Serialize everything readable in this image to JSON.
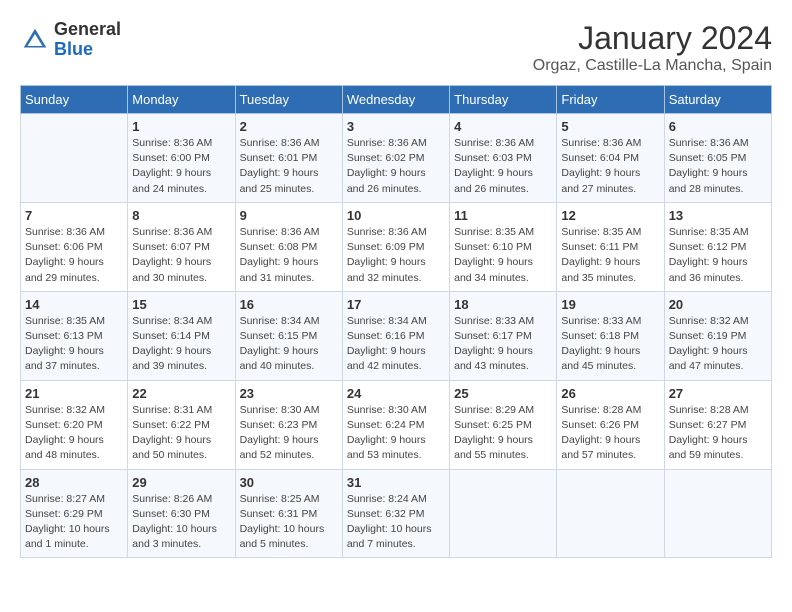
{
  "header": {
    "logo_general": "General",
    "logo_blue": "Blue",
    "title": "January 2024",
    "subtitle": "Orgaz, Castille-La Mancha, Spain"
  },
  "weekdays": [
    "Sunday",
    "Monday",
    "Tuesday",
    "Wednesday",
    "Thursday",
    "Friday",
    "Saturday"
  ],
  "weeks": [
    [
      {
        "day": "",
        "info": ""
      },
      {
        "day": "1",
        "info": "Sunrise: 8:36 AM\nSunset: 6:00 PM\nDaylight: 9 hours and 24 minutes."
      },
      {
        "day": "2",
        "info": "Sunrise: 8:36 AM\nSunset: 6:01 PM\nDaylight: 9 hours and 25 minutes."
      },
      {
        "day": "3",
        "info": "Sunrise: 8:36 AM\nSunset: 6:02 PM\nDaylight: 9 hours and 26 minutes."
      },
      {
        "day": "4",
        "info": "Sunrise: 8:36 AM\nSunset: 6:03 PM\nDaylight: 9 hours and 26 minutes."
      },
      {
        "day": "5",
        "info": "Sunrise: 8:36 AM\nSunset: 6:04 PM\nDaylight: 9 hours and 27 minutes."
      },
      {
        "day": "6",
        "info": "Sunrise: 8:36 AM\nSunset: 6:05 PM\nDaylight: 9 hours and 28 minutes."
      }
    ],
    [
      {
        "day": "7",
        "info": "Sunrise: 8:36 AM\nSunset: 6:06 PM\nDaylight: 9 hours and 29 minutes."
      },
      {
        "day": "8",
        "info": "Sunrise: 8:36 AM\nSunset: 6:07 PM\nDaylight: 9 hours and 30 minutes."
      },
      {
        "day": "9",
        "info": "Sunrise: 8:36 AM\nSunset: 6:08 PM\nDaylight: 9 hours and 31 minutes."
      },
      {
        "day": "10",
        "info": "Sunrise: 8:36 AM\nSunset: 6:09 PM\nDaylight: 9 hours and 32 minutes."
      },
      {
        "day": "11",
        "info": "Sunrise: 8:35 AM\nSunset: 6:10 PM\nDaylight: 9 hours and 34 minutes."
      },
      {
        "day": "12",
        "info": "Sunrise: 8:35 AM\nSunset: 6:11 PM\nDaylight: 9 hours and 35 minutes."
      },
      {
        "day": "13",
        "info": "Sunrise: 8:35 AM\nSunset: 6:12 PM\nDaylight: 9 hours and 36 minutes."
      }
    ],
    [
      {
        "day": "14",
        "info": "Sunrise: 8:35 AM\nSunset: 6:13 PM\nDaylight: 9 hours and 37 minutes."
      },
      {
        "day": "15",
        "info": "Sunrise: 8:34 AM\nSunset: 6:14 PM\nDaylight: 9 hours and 39 minutes."
      },
      {
        "day": "16",
        "info": "Sunrise: 8:34 AM\nSunset: 6:15 PM\nDaylight: 9 hours and 40 minutes."
      },
      {
        "day": "17",
        "info": "Sunrise: 8:34 AM\nSunset: 6:16 PM\nDaylight: 9 hours and 42 minutes."
      },
      {
        "day": "18",
        "info": "Sunrise: 8:33 AM\nSunset: 6:17 PM\nDaylight: 9 hours and 43 minutes."
      },
      {
        "day": "19",
        "info": "Sunrise: 8:33 AM\nSunset: 6:18 PM\nDaylight: 9 hours and 45 minutes."
      },
      {
        "day": "20",
        "info": "Sunrise: 8:32 AM\nSunset: 6:19 PM\nDaylight: 9 hours and 47 minutes."
      }
    ],
    [
      {
        "day": "21",
        "info": "Sunrise: 8:32 AM\nSunset: 6:20 PM\nDaylight: 9 hours and 48 minutes."
      },
      {
        "day": "22",
        "info": "Sunrise: 8:31 AM\nSunset: 6:22 PM\nDaylight: 9 hours and 50 minutes."
      },
      {
        "day": "23",
        "info": "Sunrise: 8:30 AM\nSunset: 6:23 PM\nDaylight: 9 hours and 52 minutes."
      },
      {
        "day": "24",
        "info": "Sunrise: 8:30 AM\nSunset: 6:24 PM\nDaylight: 9 hours and 53 minutes."
      },
      {
        "day": "25",
        "info": "Sunrise: 8:29 AM\nSunset: 6:25 PM\nDaylight: 9 hours and 55 minutes."
      },
      {
        "day": "26",
        "info": "Sunrise: 8:28 AM\nSunset: 6:26 PM\nDaylight: 9 hours and 57 minutes."
      },
      {
        "day": "27",
        "info": "Sunrise: 8:28 AM\nSunset: 6:27 PM\nDaylight: 9 hours and 59 minutes."
      }
    ],
    [
      {
        "day": "28",
        "info": "Sunrise: 8:27 AM\nSunset: 6:29 PM\nDaylight: 10 hours and 1 minute."
      },
      {
        "day": "29",
        "info": "Sunrise: 8:26 AM\nSunset: 6:30 PM\nDaylight: 10 hours and 3 minutes."
      },
      {
        "day": "30",
        "info": "Sunrise: 8:25 AM\nSunset: 6:31 PM\nDaylight: 10 hours and 5 minutes."
      },
      {
        "day": "31",
        "info": "Sunrise: 8:24 AM\nSunset: 6:32 PM\nDaylight: 10 hours and 7 minutes."
      },
      {
        "day": "",
        "info": ""
      },
      {
        "day": "",
        "info": ""
      },
      {
        "day": "",
        "info": ""
      }
    ]
  ]
}
